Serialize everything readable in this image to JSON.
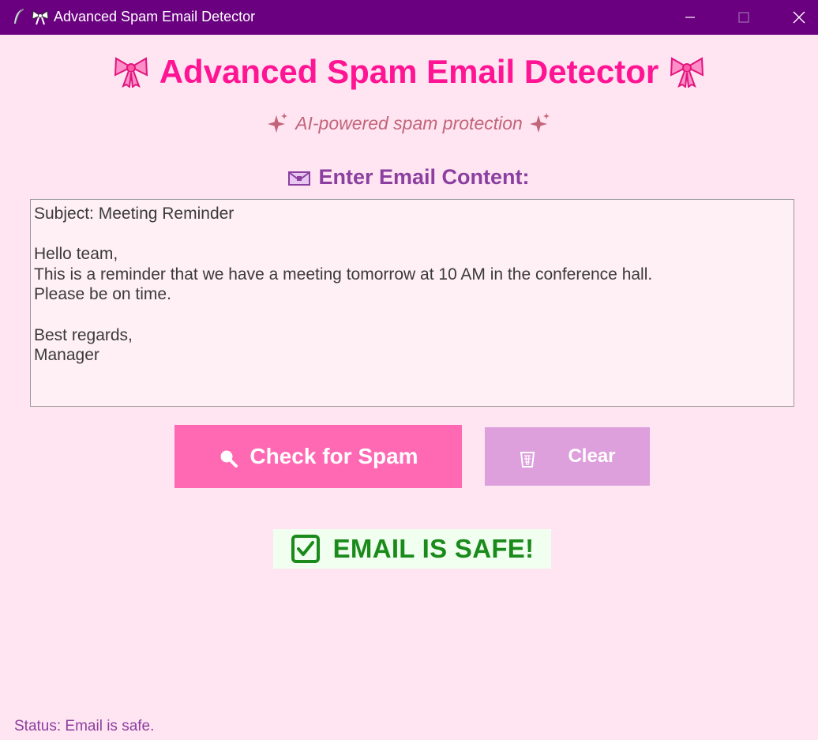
{
  "window": {
    "title": "Advanced Spam Email Detector",
    "icons": [
      "feather-icon",
      "bow-icon"
    ],
    "controls": [
      "minimize-icon",
      "maximize-icon",
      "close-icon"
    ]
  },
  "header": {
    "title": "Advanced Spam Email Detector",
    "subtitle": "AI-powered spam protection"
  },
  "input": {
    "label": "Enter Email Content:",
    "value": "Subject: Meeting Reminder\n\nHello team,\nThis is a reminder that we have a meeting tomorrow at 10 AM in the conference hall.\nPlease be on time.\n\nBest regards,\nManager"
  },
  "buttons": {
    "check_label": "Check for Spam",
    "clear_label": "Clear"
  },
  "result": {
    "text": "EMAIL IS SAFE!"
  },
  "status": {
    "text": "Status: Email is safe."
  },
  "colors": {
    "titlebar": "#6a0080",
    "background": "#ffe4f1",
    "heading": "#ff1493",
    "check_button": "#ff69b4",
    "clear_button": "#dda0dd",
    "safe_text": "#1a8a1a"
  }
}
